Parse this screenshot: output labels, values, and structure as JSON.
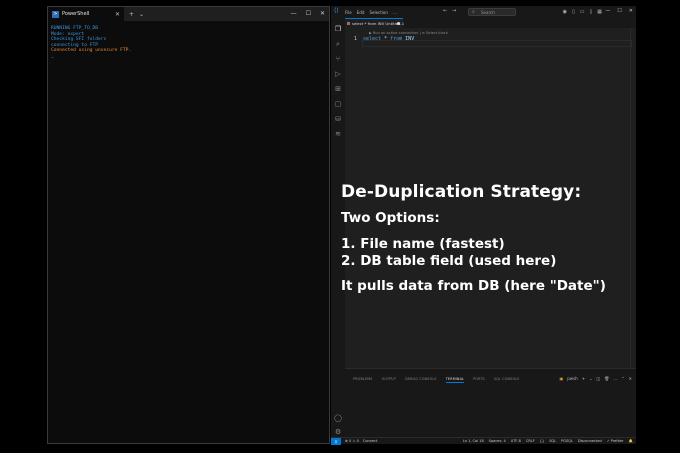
{
  "powershell": {
    "tab_title": "PowerShell",
    "lines": [
      {
        "text": "RUNNING FTP_TO_DB",
        "color": "#3a96dd"
      },
      {
        "text": "Mode: expert",
        "color": "#3a96dd"
      },
      {
        "text": "Checking SFI folders",
        "color": "#3a96dd"
      },
      {
        "text": "connecting to FTP",
        "color": "#3a96dd"
      },
      {
        "text": "Connected using unsecure FTP.",
        "color": "#e8893a"
      },
      {
        "text": "_",
        "color": "#cccccc"
      }
    ]
  },
  "vscode": {
    "menu": [
      "File",
      "Edit",
      "Selection",
      "…"
    ],
    "search_placeholder": "Search",
    "tab_label": "select * from INV Untitled-1",
    "codelens": "▶ Run on active connection | ≡ Select block",
    "line_number": "1",
    "code": {
      "kw1": "select",
      "op": "*",
      "kw2": "from",
      "table": "INV"
    },
    "panel_tabs": [
      "PROBLEMS",
      "OUTPUT",
      "DEBUG CONSOLE",
      "TERMINAL",
      "PORTS",
      "SQL CONSOLE"
    ],
    "active_panel_tab": "TERMINAL",
    "panel_shell": "pwsh",
    "status": {
      "errors": "⊗ 0 ⚠ 0",
      "connect": "Connect",
      "position": "Ln 1, Col 18",
      "spaces": "Spaces: 4",
      "encoding": "UTF-8",
      "eol": "CRLF",
      "lang_braces": "{}",
      "language": "SQL",
      "dialect": "PGSQL",
      "connection": "Disconnected",
      "prettier": "✓ Prettier"
    }
  },
  "overlay": {
    "title": "De-Duplication Strategy:",
    "options_heading": "Two Options:",
    "item1": "1. File name (fastest)",
    "item2": "2. DB table field (used here)",
    "note": "It pulls data from DB (here \"Date\")"
  }
}
